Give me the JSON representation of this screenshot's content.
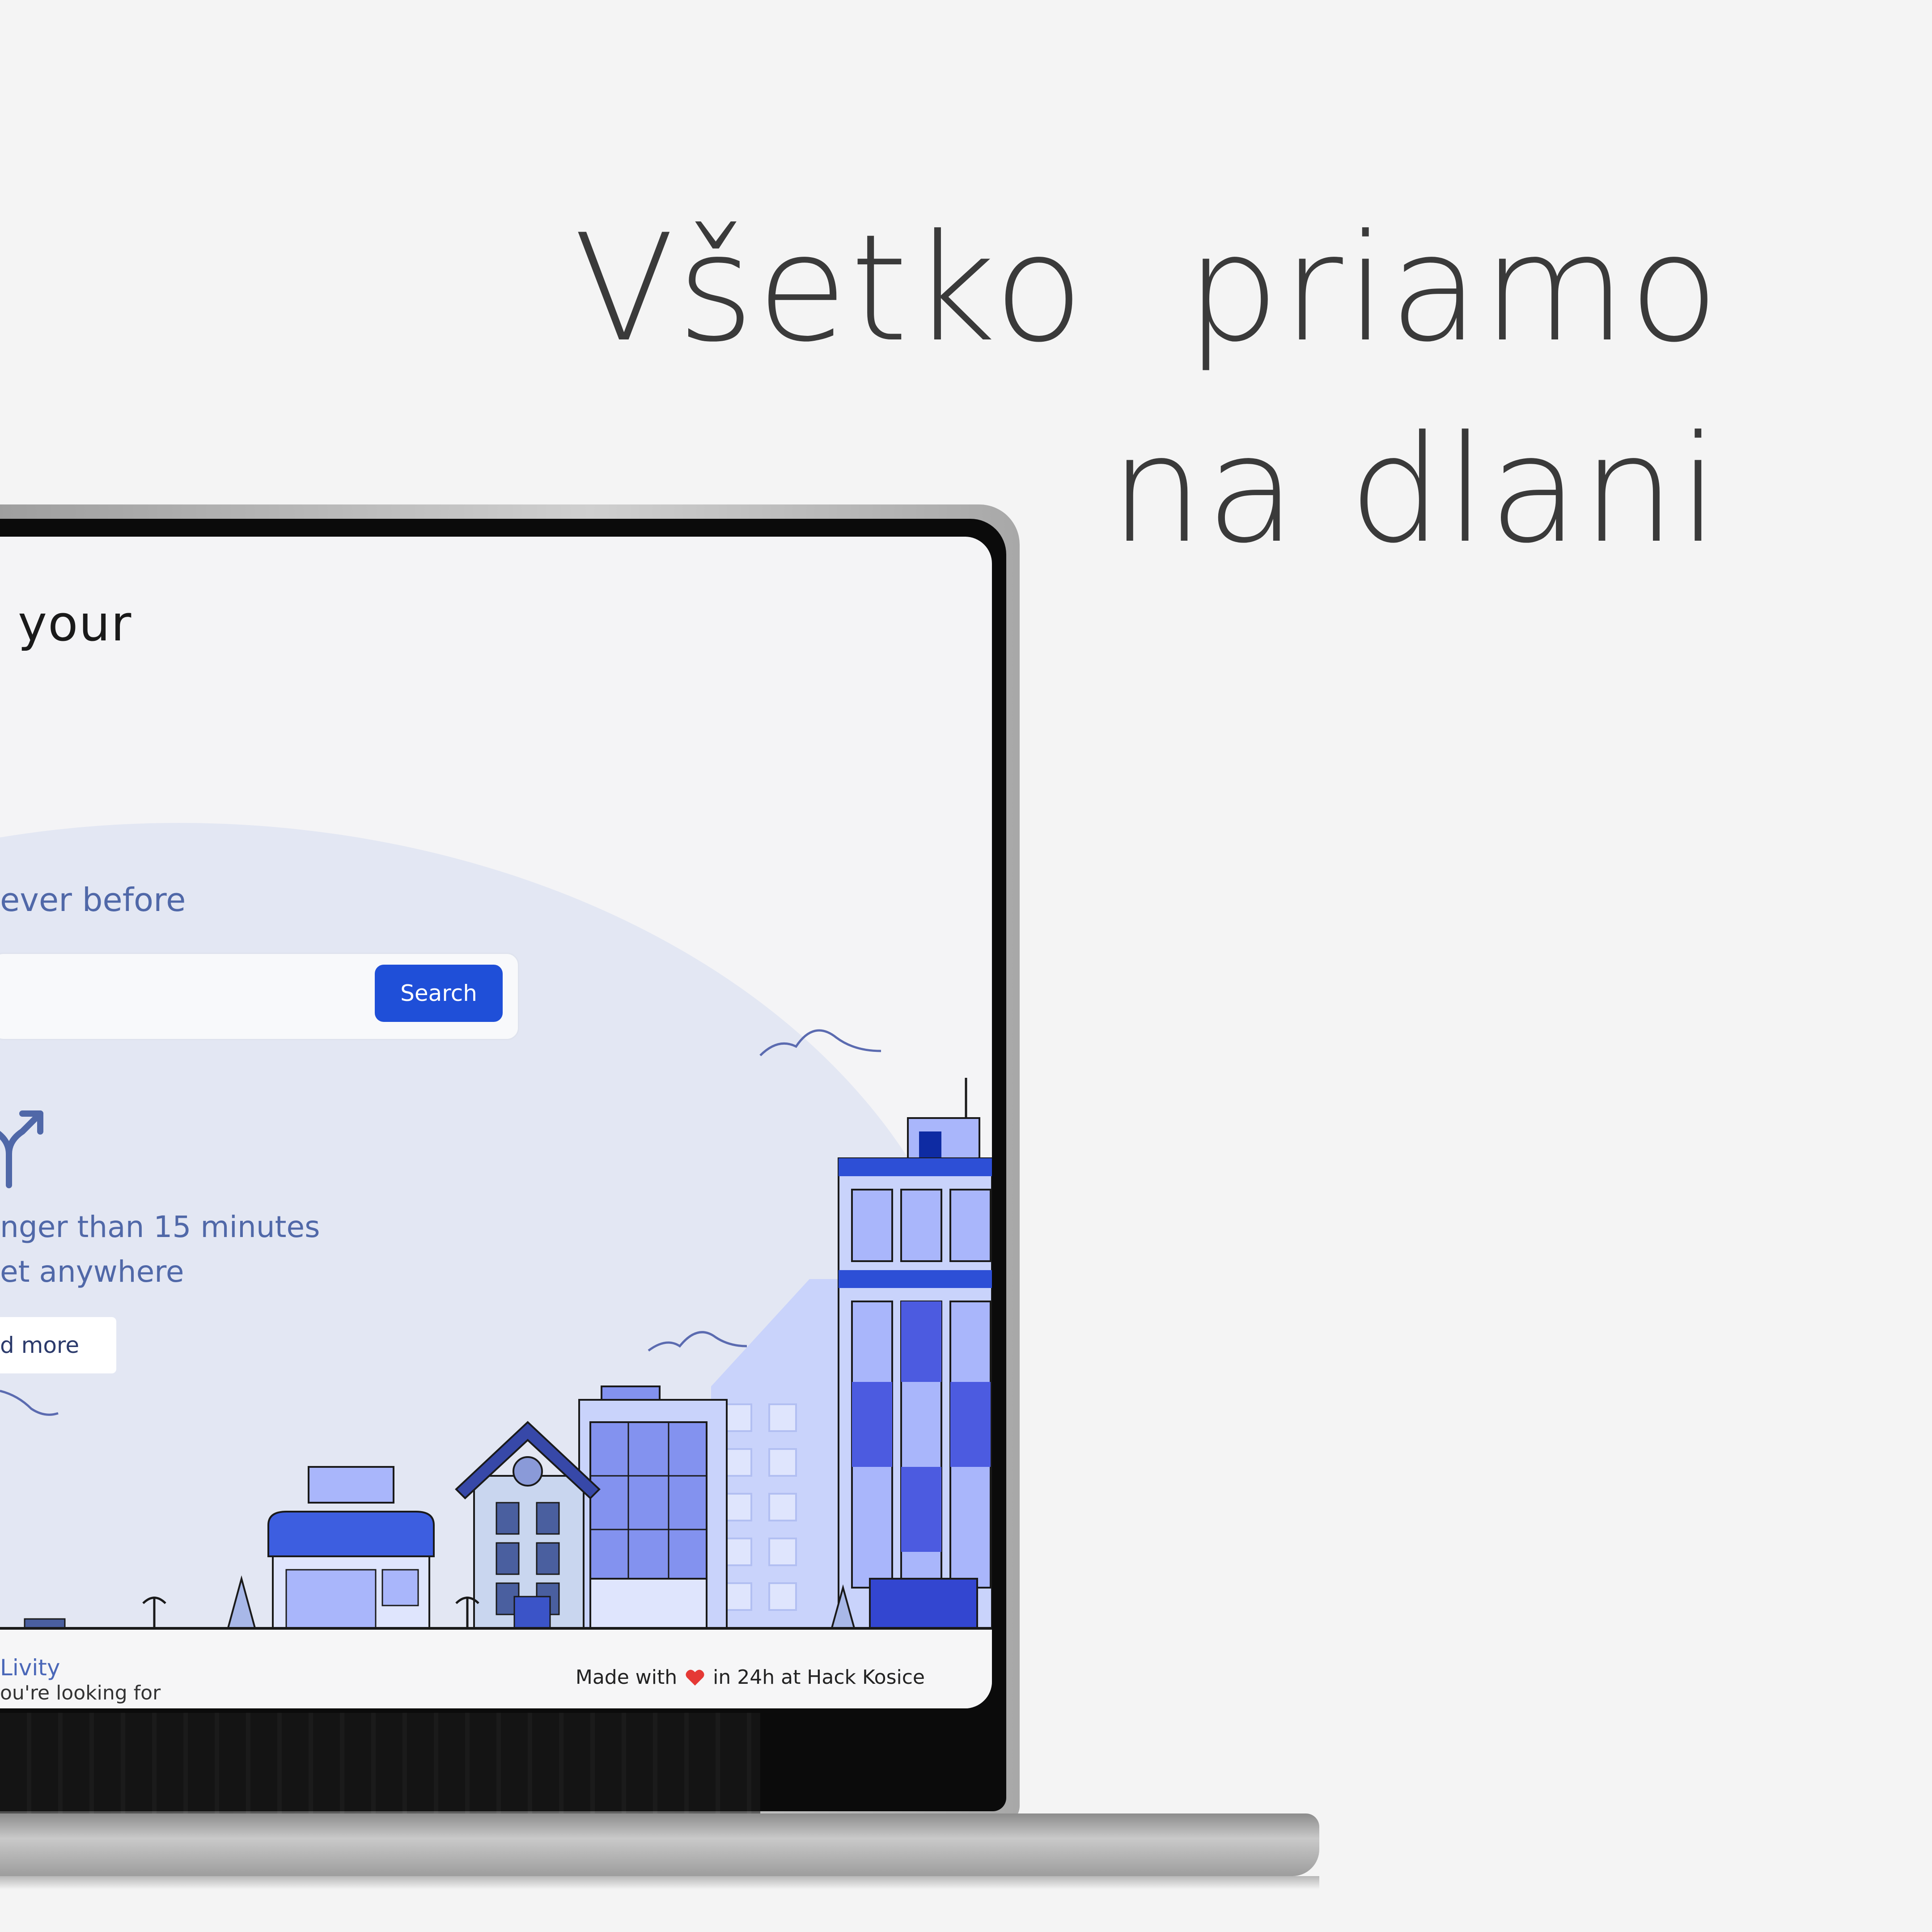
{
  "headline": {
    "line1": "Všetko  priamo",
    "line2": "na dlani"
  },
  "screen": {
    "hero_title": "your",
    "hero_subtitle": "ever before",
    "search": {
      "placeholder": "",
      "button_label": "Search"
    },
    "info_line1": "nger than 15 minutes",
    "info_line2": "et anywhere",
    "more_button": "d more",
    "footer": {
      "brand": "Livity",
      "tagline": "ou're looking for",
      "made_with_prefix": "Made with",
      "made_with_suffix": "in 24h at Hack Kosice"
    },
    "icons": {
      "split": "split-arrow-icon",
      "heart": "heart-icon"
    }
  },
  "colors": {
    "accent": "#1f4fd8",
    "hero_bg": "#e3e7f3",
    "text_blue": "#5068a8",
    "page_bg": "#f4f4f4",
    "heart": "#e53935"
  }
}
